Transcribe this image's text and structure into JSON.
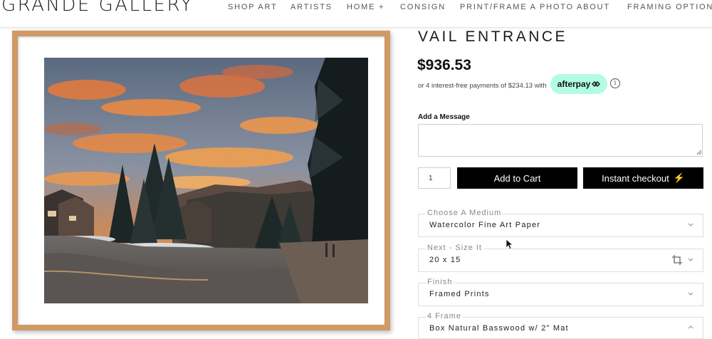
{
  "header": {
    "logo": "GRANDE GALLERY",
    "nav": [
      "SHOP ART",
      "ARTISTS",
      "HOME +",
      "CONSIGN",
      "PRINT/FRAME A PHOTO",
      "ABOUT",
      "FRAMING OPTIONS"
    ]
  },
  "product": {
    "title": "VAIL ENTRANCE",
    "price": "$936.53",
    "afterpay_text": "or 4 interest-free payments of $234.13 with",
    "afterpay_badge": "afterpay",
    "info_glyph": "i",
    "message_label": "Add a Message",
    "message_value": "",
    "quantity": "1",
    "add_to_cart": "Add to Cart",
    "instant_checkout": "Instant checkout",
    "bolt_glyph": "⚡",
    "options": [
      {
        "label": "Choose A Medium",
        "value": "Watercolor Fine Art Paper",
        "expanded": false
      },
      {
        "label": "Next - Size It",
        "value": "20 x 15",
        "expanded": false,
        "icon": "crop-icon"
      },
      {
        "label": "Finish",
        "value": "Framed Prints",
        "expanded": false
      },
      {
        "label": "4 Frame",
        "value": "Box Natural Basswood w/ 2\" Mat",
        "expanded": true
      }
    ]
  },
  "colors": {
    "frame": "#cf9a66",
    "afterpay_mint": "#b2fce4",
    "button": "#000000"
  }
}
